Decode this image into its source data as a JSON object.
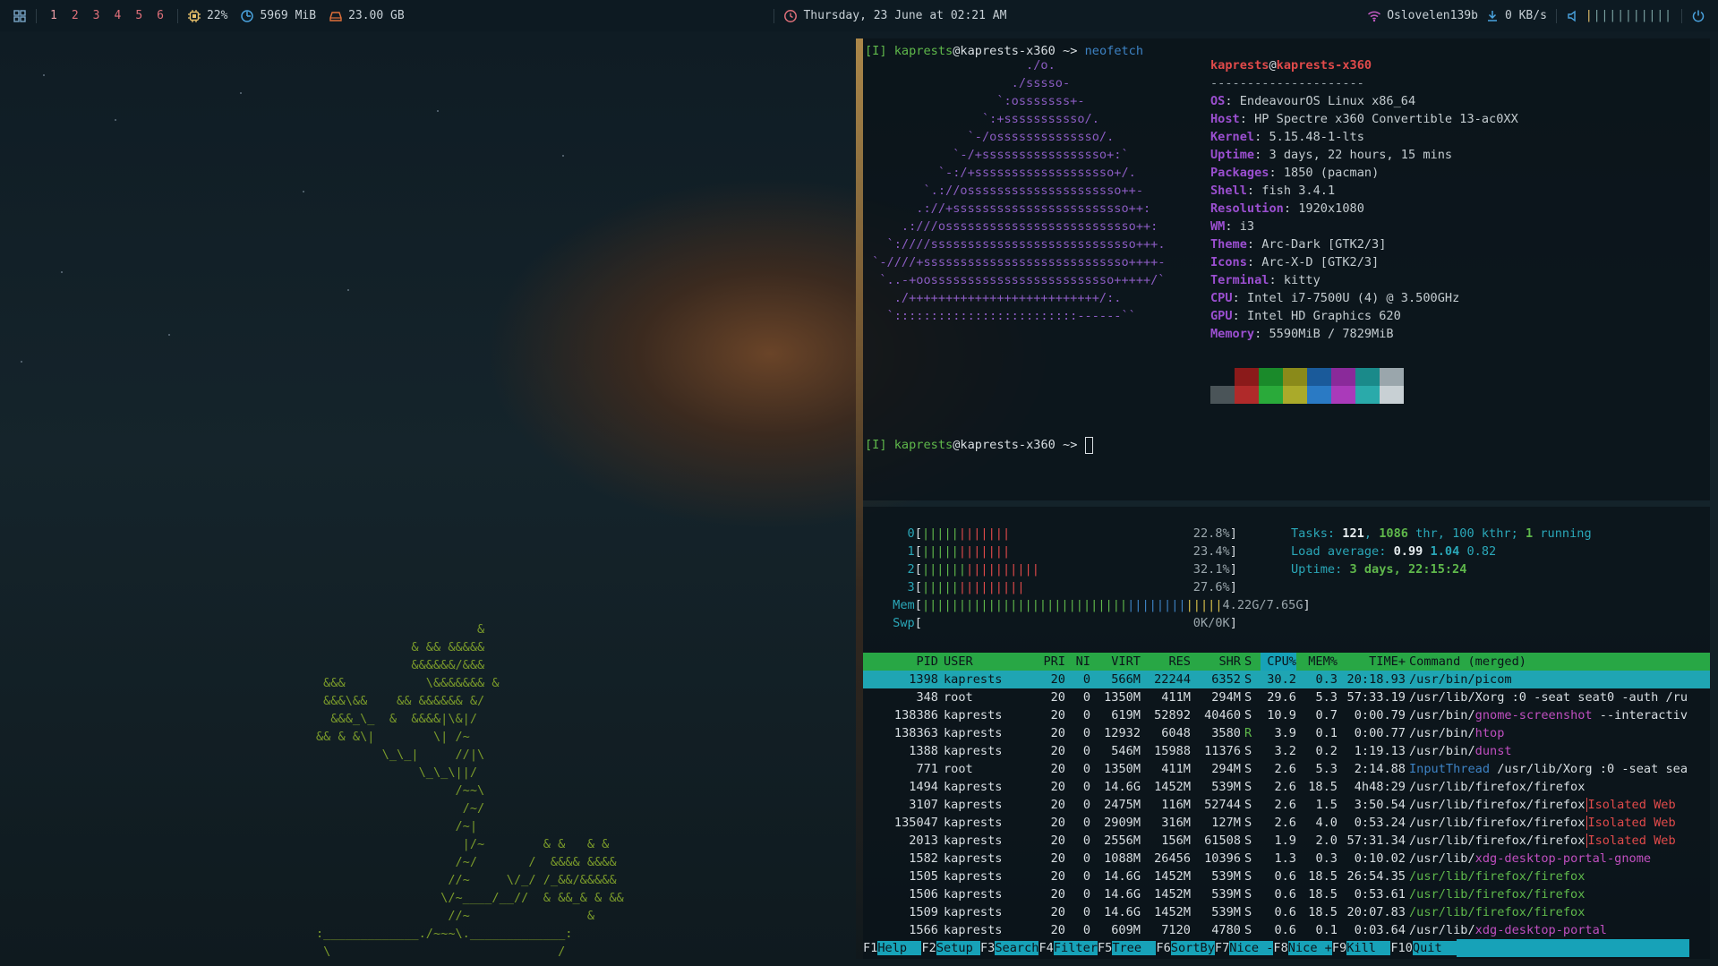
{
  "topbar": {
    "workspaces": [
      "1",
      "2",
      "3",
      "4",
      "5",
      "6"
    ],
    "cpu": "22%",
    "memory": "5969 MiB",
    "disk": "23.00 GB",
    "datetime": "Thursday, 23 June at 02:21 AM",
    "wifi": "Oslovelen139b",
    "net_speed": "0 KB/s",
    "volume_bars": "||||||||||",
    "volume_level": 0.1,
    "colors": {
      "accent": "#e0707a",
      "bar_bg": "#0d1a22",
      "cpu_icon": "#e8c16b",
      "mem_icon": "#4aa3df",
      "disk_icon": "#e0703a"
    }
  },
  "neofetch": {
    "prompt_user": "kaprests",
    "prompt_host": "kaprests-x360",
    "prompt_mode": "[I]",
    "prompt_path": "~",
    "command": "neofetch",
    "title_user": "kaprests",
    "title_host": "kaprests-x360",
    "title_rule": "---------------------",
    "info": [
      {
        "key": "OS",
        "value": "EndeavourOS Linux x86_64"
      },
      {
        "key": "Host",
        "value": "HP Spectre x360 Convertible 13-ac0XX"
      },
      {
        "key": "Kernel",
        "value": "5.15.48-1-lts"
      },
      {
        "key": "Uptime",
        "value": "3 days, 22 hours, 15 mins"
      },
      {
        "key": "Packages",
        "value": "1850 (pacman)"
      },
      {
        "key": "Shell",
        "value": "fish 3.4.1"
      },
      {
        "key": "Resolution",
        "value": "1920x1080"
      },
      {
        "key": "WM",
        "value": "i3"
      },
      {
        "key": "Theme",
        "value": "Arc-Dark [GTK2/3]"
      },
      {
        "key": "Icons",
        "value": "Arc-X-D [GTK2/3]"
      },
      {
        "key": "Terminal",
        "value": "kitty"
      },
      {
        "key": "CPU",
        "value": "Intel i7-7500U (4) @ 3.500GHz"
      },
      {
        "key": "GPU",
        "value": "Intel HD Graphics 620"
      },
      {
        "key": "Memory",
        "value": "5590MiB / 7829MiB"
      }
    ],
    "palette_top": [
      "#0b141a",
      "#8b1a1a",
      "#1a8a2a",
      "#8a8a1a",
      "#1a5a9a",
      "#8a2a9a",
      "#1a8a8a",
      "#9aa6ac"
    ],
    "palette_bottom": [
      "#4a5458",
      "#b02a2a",
      "#2aaa3a",
      "#aaaa2a",
      "#2a7ac4",
      "#aa3aba",
      "#2aaaaa",
      "#c8d0d4"
    ],
    "logo": [
      "                      ./o.",
      "                    ./sssso-",
      "                  `:osssssss+-",
      "                `:+sssssssssso/.",
      "              `-/ossssssssssssso/.",
      "            `-/+sssssssssssssssso+:`",
      "          `-:/+sssssssssssssssssso+/.",
      "        `.://osssssssssssssssssssso++-",
      "       .://+ssssssssssssssssssssssso++:",
      "     .:///ossssssssssssssssssssssssso++:",
      "   `:////ssssssssssssssssssssssssssso+++.",
      " `-////+ssssssssssssssssssssssssssso++++-",
      "  `..-+oosssssssssssssssssssssssso+++++/`",
      "    ./++++++++++++++++++++++++++/:.",
      "   `:::::::::::::::::::::::::------``"
    ]
  },
  "htop": {
    "cpus": [
      {
        "id": "0",
        "bar": "||||||||||||",
        "pct": "22.8%"
      },
      {
        "id": "1",
        "bar": "||||||||||||",
        "pct": "23.4%"
      },
      {
        "id": "2",
        "bar": "||||||||||||||||",
        "pct": "32.1%"
      },
      {
        "id": "3",
        "bar": "||||||||||||||",
        "pct": "27.6%"
      }
    ],
    "mem_label": "Mem",
    "mem_bar": "|||||||||||||||||||||||||||||||||||||||||",
    "mem_value": "4.22G/7.65G",
    "swp_label": "Swp",
    "swp_value": "0K/0K",
    "tasks_label": "Tasks:",
    "tasks": "121",
    "threads": "1086",
    "thr_label": "thr,",
    "kthreads": "100 kthr;",
    "running": "1",
    "running_label": "running",
    "load_label": "Load average:",
    "load1": "0.99",
    "load5": "1.04",
    "load15": "0.82",
    "uptime_label": "Uptime:",
    "uptime": "3 days, 22:15:24",
    "columns": [
      "PID",
      "USER",
      "PRI",
      "NI",
      "VIRT",
      "RES",
      "SHR",
      "S",
      "CPU%",
      "MEM%",
      "TIME+",
      "Command (merged)"
    ],
    "rows": [
      {
        "pid": "1398",
        "user": "kaprests",
        "pri": "20",
        "ni": "0",
        "virt": "566M",
        "res": "22244",
        "shr": "6352",
        "s": "S",
        "cpu": "30.2",
        "mem": "0.3",
        "time": "20:18.93",
        "cmd": "/usr/bin/picom",
        "extra": ""
      },
      {
        "pid": "348",
        "user": "root",
        "pri": "20",
        "ni": "0",
        "virt": "1350M",
        "res": "411M",
        "shr": "294M",
        "s": "S",
        "cpu": "29.6",
        "mem": "5.3",
        "time": "57:33.19",
        "cmd": "/usr/lib/Xorg :0 -seat seat0 -auth /ru",
        "extra": ""
      },
      {
        "pid": "138386",
        "user": "kaprests",
        "pri": "20",
        "ni": "0",
        "virt": "619M",
        "res": "52892",
        "shr": "40460",
        "s": "S",
        "cpu": "10.9",
        "mem": "0.7",
        "time": "0:00.79",
        "cmd": "/usr/bin/gnome-screenshot --interactiv",
        "extra": ""
      },
      {
        "pid": "138363",
        "user": "kaprests",
        "pri": "20",
        "ni": "0",
        "virt": "12932",
        "res": "6048",
        "shr": "3580",
        "s": "R",
        "cpu": "3.9",
        "mem": "0.1",
        "time": "0:00.77",
        "cmd": "/usr/bin/htop",
        "extra": ""
      },
      {
        "pid": "1388",
        "user": "kaprests",
        "pri": "20",
        "ni": "0",
        "virt": "546M",
        "res": "15988",
        "shr": "11376",
        "s": "S",
        "cpu": "3.2",
        "mem": "0.2",
        "time": "1:19.13",
        "cmd": "/usr/bin/dunst",
        "extra": ""
      },
      {
        "pid": "771",
        "user": "root",
        "pri": "20",
        "ni": "0",
        "virt": "1350M",
        "res": "411M",
        "shr": "294M",
        "s": "S",
        "cpu": "2.6",
        "mem": "5.3",
        "time": "2:14.88",
        "cmd": "InputThread /usr/lib/Xorg :0 -seat sea",
        "extra": ""
      },
      {
        "pid": "1494",
        "user": "kaprests",
        "pri": "20",
        "ni": "0",
        "virt": "14.6G",
        "res": "1452M",
        "shr": "539M",
        "s": "S",
        "cpu": "2.6",
        "mem": "18.5",
        "time": "4h48:29",
        "cmd": "/usr/lib/firefox/firefox",
        "extra": ""
      },
      {
        "pid": "3107",
        "user": "kaprests",
        "pri": "20",
        "ni": "0",
        "virt": "2475M",
        "res": "116M",
        "shr": "52744",
        "s": "S",
        "cpu": "2.6",
        "mem": "1.5",
        "time": "3:50.54",
        "cmd": "/usr/lib/firefox/firefox",
        "extra": "Isolated Web"
      },
      {
        "pid": "135047",
        "user": "kaprests",
        "pri": "20",
        "ni": "0",
        "virt": "2909M",
        "res": "316M",
        "shr": "127M",
        "s": "S",
        "cpu": "2.6",
        "mem": "4.0",
        "time": "0:53.24",
        "cmd": "/usr/lib/firefox/firefox",
        "extra": "Isolated Web"
      },
      {
        "pid": "2013",
        "user": "kaprests",
        "pri": "20",
        "ni": "0",
        "virt": "2556M",
        "res": "156M",
        "shr": "61508",
        "s": "S",
        "cpu": "1.9",
        "mem": "2.0",
        "time": "57:31.34",
        "cmd": "/usr/lib/firefox/firefox",
        "extra": "Isolated Web"
      },
      {
        "pid": "1582",
        "user": "kaprests",
        "pri": "20",
        "ni": "0",
        "virt": "1088M",
        "res": "26456",
        "shr": "10396",
        "s": "S",
        "cpu": "1.3",
        "mem": "0.3",
        "time": "0:10.02",
        "cmd": "/usr/lib/xdg-desktop-portal-gnome",
        "extra": ""
      },
      {
        "pid": "1505",
        "user": "kaprests",
        "pri": "20",
        "ni": "0",
        "virt": "14.6G",
        "res": "1452M",
        "shr": "539M",
        "s": "S",
        "cpu": "0.6",
        "mem": "18.5",
        "time": "26:54.35",
        "cmd": "/usr/lib/firefox/firefox",
        "extra": ""
      },
      {
        "pid": "1506",
        "user": "kaprests",
        "pri": "20",
        "ni": "0",
        "virt": "14.6G",
        "res": "1452M",
        "shr": "539M",
        "s": "S",
        "cpu": "0.6",
        "mem": "18.5",
        "time": "0:53.61",
        "cmd": "/usr/lib/firefox/firefox",
        "extra": ""
      },
      {
        "pid": "1509",
        "user": "kaprests",
        "pri": "20",
        "ni": "0",
        "virt": "14.6G",
        "res": "1452M",
        "shr": "539M",
        "s": "S",
        "cpu": "0.6",
        "mem": "18.5",
        "time": "20:07.83",
        "cmd": "/usr/lib/firefox/firefox",
        "extra": ""
      },
      {
        "pid": "1566",
        "user": "kaprests",
        "pri": "20",
        "ni": "0",
        "virt": "609M",
        "res": "7120",
        "shr": "4780",
        "s": "S",
        "cpu": "0.6",
        "mem": "0.1",
        "time": "0:03.64",
        "cmd": "/usr/lib/xdg-desktop-portal",
        "extra": ""
      }
    ],
    "fkeys": [
      {
        "num": "F1",
        "label": "Help  "
      },
      {
        "num": "F2",
        "label": "Setup "
      },
      {
        "num": "F3",
        "label": "Search"
      },
      {
        "num": "F4",
        "label": "Filter"
      },
      {
        "num": "F5",
        "label": "Tree  "
      },
      {
        "num": "F6",
        "label": "SortBy"
      },
      {
        "num": "F7",
        "label": "Nice -"
      },
      {
        "num": "F8",
        "label": "Nice +"
      },
      {
        "num": "F9",
        "label": "Kill  "
      },
      {
        "num": "F10",
        "label": "Quit  "
      }
    ]
  },
  "tree_ascii": [
    "                      &",
    "             & && &&&&&",
    "             &&&&&&/&&&",
    " &&&           \\&&&&&&& &",
    " &&&\\&&    && &&&&&& &/",
    "  &&&_\\_  &  &&&&|\\&|/",
    "&& & &\\|        \\| /~",
    "         \\_\\_|     //|\\",
    "              \\_\\_\\||/",
    "                   /~~\\",
    "                    /~/",
    "                   /~|",
    "                    |/~        & &   & &",
    "                   /~/       /  &&&& &&&&",
    "                  //~     \\/_/ /_&&/&&&&&",
    "                 \\/~____/__//  & &&_& & &&",
    "                  //~                &",
    ":_____________./~~~\\._____________:",
    " \\                               /",
    "  \\_____________________________/",
    "   (_)                       (_)"
  ]
}
